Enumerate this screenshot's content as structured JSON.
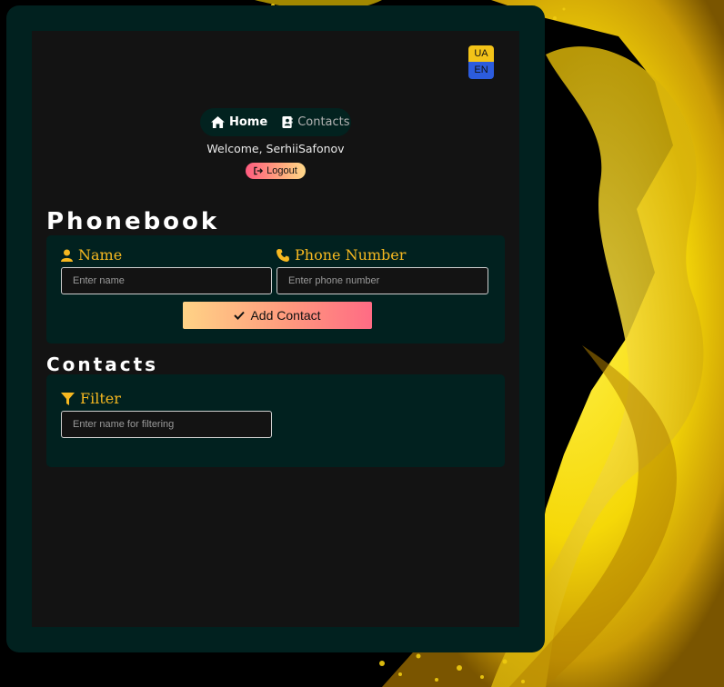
{
  "lang": {
    "ua": "UA",
    "en": "EN"
  },
  "nav": {
    "home": "Home",
    "contacts": "Contacts"
  },
  "user": {
    "welcome": "Welcome, SerhiiSafonov",
    "logout": "Logout"
  },
  "phonebook": {
    "title": "Phonebook",
    "name_label": "Name",
    "name_placeholder": "Enter name",
    "phone_label": "Phone Number",
    "phone_placeholder": "Enter phone number",
    "add_button": "Add Contact"
  },
  "contacts": {
    "title": "Contacts",
    "filter_label": "Filter",
    "filter_placeholder": "Enter name for filtering"
  },
  "colors": {
    "accent": "#f6b820",
    "panel": "#01211f",
    "background": "#131313",
    "lang_ua": "#f3c318",
    "lang_en": "#2c5cde"
  }
}
